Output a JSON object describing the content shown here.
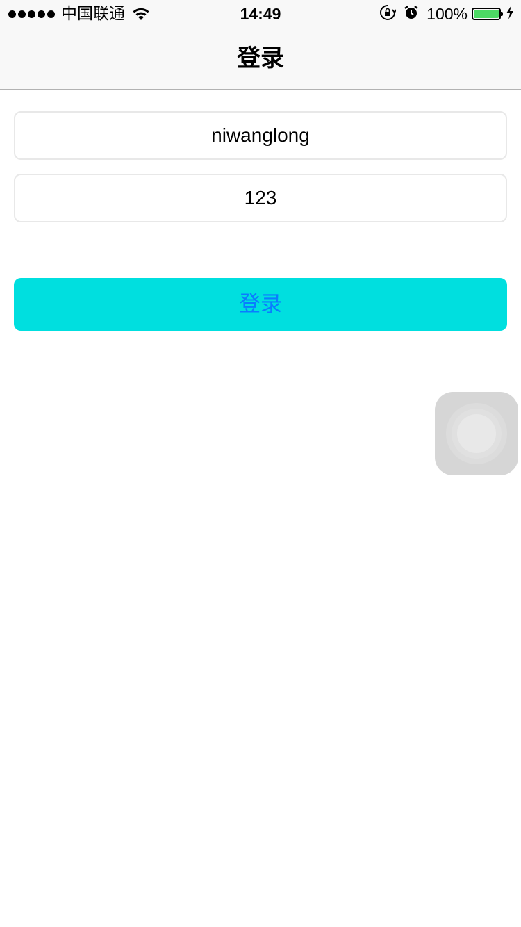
{
  "status_bar": {
    "carrier": "中国联通",
    "time": "14:49",
    "battery_percent": "100%",
    "icons": [
      "signal-dots-icon",
      "wifi-icon",
      "orientation-lock-icon",
      "alarm-icon",
      "battery-icon",
      "charging-bolt-icon"
    ],
    "battery_color": "#4cd964"
  },
  "nav": {
    "title": "登录"
  },
  "form": {
    "username_value": "niwanglong",
    "password_value": "123",
    "login_label": "登录",
    "button_color": "#00dfdf",
    "button_text_color": "#0a7cff"
  },
  "assistive_touch": {
    "icon": "assistive-touch-icon"
  }
}
